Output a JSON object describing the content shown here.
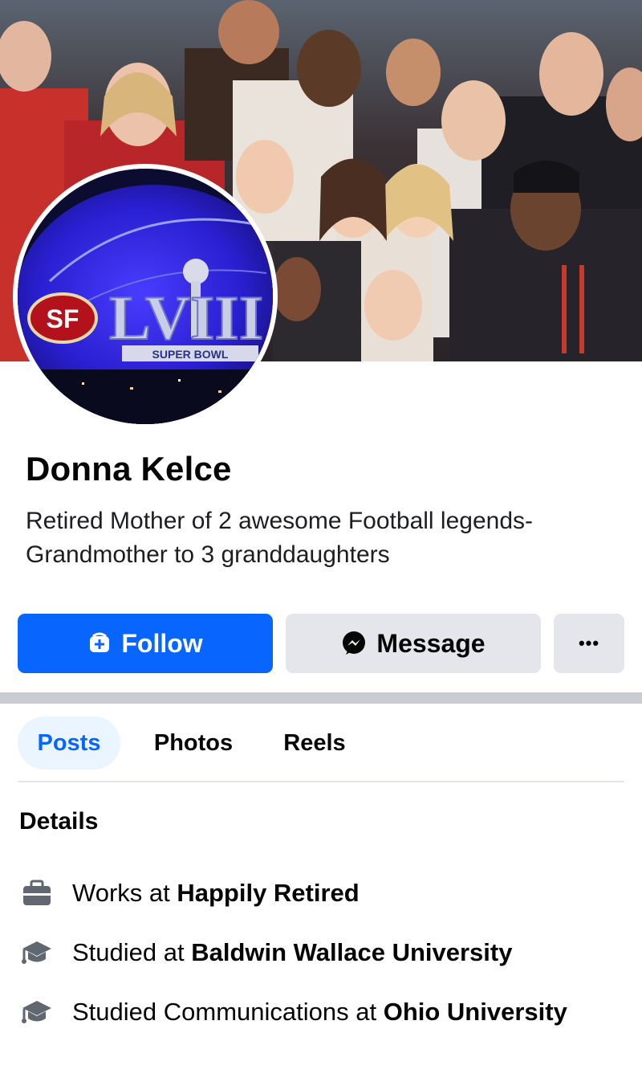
{
  "profile": {
    "name": "Donna Kelce",
    "bio": "Retired Mother of 2 awesome Football legends- Grandmother to 3 granddaughters"
  },
  "actions": {
    "follow_label": "Follow",
    "message_label": "Message",
    "more_label": "•••"
  },
  "tabs": [
    {
      "label": "Posts",
      "active": true
    },
    {
      "label": "Photos",
      "active": false
    },
    {
      "label": "Reels",
      "active": false
    }
  ],
  "details": {
    "title": "Details",
    "items": [
      {
        "icon": "briefcase-icon",
        "prefix": "Works at ",
        "emphasis": "Happily Retired"
      },
      {
        "icon": "graduation-cap-icon",
        "prefix": "Studied at ",
        "emphasis": "Baldwin Wallace University"
      },
      {
        "icon": "graduation-cap-icon",
        "prefix": "Studied Communications at ",
        "emphasis": "Ohio University"
      }
    ]
  },
  "avatar": {
    "logo_text": "SF",
    "trophy_text": "LVIII",
    "banner_text": "SUPER BOWL"
  },
  "colors": {
    "accent": "#0866ff",
    "button_gray": "#e4e6eb",
    "tab_active_bg": "#ebf5ff",
    "text": "#050505"
  }
}
